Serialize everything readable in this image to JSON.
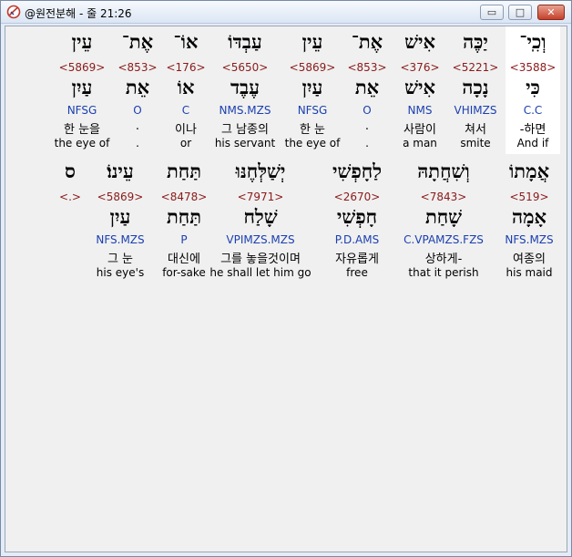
{
  "window": {
    "title": "@원전분해 - 줄 21:26",
    "controls": {
      "minimize": "▭",
      "maximize": "□",
      "close": "✕"
    }
  },
  "rows": [
    {
      "words": [
        {
          "hebrew": "וְכִֽי־",
          "strong": "<3588>",
          "lemma": "כִּי",
          "morph": "C.C",
          "korean": "-하면",
          "english": "And if",
          "highlight": true
        },
        {
          "hebrew": "יַכֶּה",
          "strong": "<5221>",
          "lemma": "נָכָה",
          "morph": "VHIMZS",
          "korean": "쳐서",
          "english": "smite"
        },
        {
          "hebrew": "אִישׁ",
          "strong": "<376>",
          "lemma": "אִישׁ",
          "morph": "NMS",
          "korean": "사람이",
          "english": "a man"
        },
        {
          "hebrew": "אֶת־",
          "strong": "<853>",
          "lemma": "אֵת",
          "morph": "O",
          "korean": ".",
          "english": "."
        },
        {
          "hebrew": "עֵין",
          "strong": "<5869>",
          "lemma": "עַיִן",
          "morph": "NFSG",
          "korean": "한 눈",
          "english": "the eye of"
        },
        {
          "hebrew": "עַבְדּוֹ",
          "strong": "<5650>",
          "lemma": "עֶבֶד",
          "morph": "NMS.MZS",
          "korean": "그 남종의",
          "english": "his servant"
        },
        {
          "hebrew": "אוֹ־",
          "strong": "<176>",
          "lemma": "אוֹ",
          "morph": "C",
          "korean": "이나",
          "english": "or"
        },
        {
          "hebrew": "אֶת־",
          "strong": "<853>",
          "lemma": "אֵת",
          "morph": "O",
          "korean": ".",
          "english": "."
        },
        {
          "hebrew": "עֵין",
          "strong": "<5869>",
          "lemma": "עַיִן",
          "morph": "NFSG",
          "korean": "한 눈을",
          "english": "the eye of"
        }
      ]
    },
    {
      "words": [
        {
          "hebrew": "אֲמָתוֹ",
          "strong": "<519>",
          "lemma": "אָמָה",
          "morph": "NFS.MZS",
          "korean": "여종의",
          "english": "his maid"
        },
        {
          "hebrew": "וְשִׁחֲתָהּ",
          "strong": "<7843>",
          "lemma": "שָׁחַת",
          "morph": "C.VPAMZS.FZS",
          "korean": "상하게-",
          "english": "that it perish"
        },
        {
          "hebrew": "לַחָפְשִׁי",
          "strong": "<2670>",
          "lemma": "חָפְשִׁי",
          "morph": "P.D.AMS",
          "korean": "자유롭게",
          "english": "free"
        },
        {
          "hebrew": "יְשַׁלְּחֶנּוּ",
          "strong": "<7971>",
          "lemma": "שָׁלַח",
          "morph": "VPIMZS.MZS",
          "korean": "그를 놓을것이며",
          "english": "he shall let him go"
        },
        {
          "hebrew": "תַּחַת",
          "strong": "<8478>",
          "lemma": "תַּחַת",
          "morph": "P",
          "korean": "대신에",
          "english": "for-sake"
        },
        {
          "hebrew": "עֵינוֹ׃",
          "strong": "<5869>",
          "lemma": "עַיִן",
          "morph": "NFS.MZS",
          "korean": "그 눈",
          "english": "his eye's"
        },
        {
          "hebrew": "ס",
          "strong": "<.>",
          "lemma": "",
          "morph": "",
          "korean": "",
          "english": ""
        }
      ]
    }
  ]
}
